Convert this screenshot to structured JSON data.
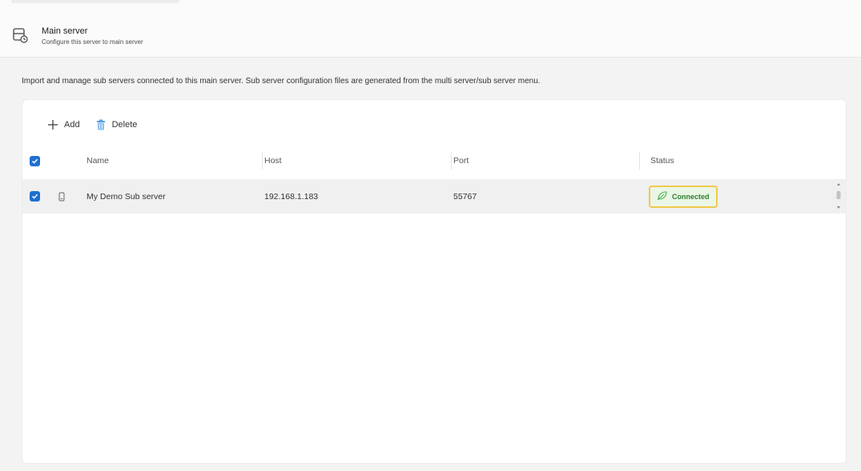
{
  "header": {
    "title": "Main server",
    "subtitle": "Configure this server to main server",
    "icon": "server-icon"
  },
  "description": "Import and manage sub servers connected to this main server. Sub server configuration files are generated from the multi server/sub server menu.",
  "toolbar": {
    "add_label": "Add",
    "delete_label": "Delete"
  },
  "table": {
    "columns": [
      "Name",
      "Host",
      "Port",
      "Status"
    ],
    "rows": [
      {
        "selected": true,
        "name": "My Demo Sub server",
        "host": "192.168.1.183",
        "port": "55767",
        "status": "Connected"
      }
    ]
  },
  "colors": {
    "accent": "#1f6fd1",
    "status_connected_text": "#2f7d32",
    "status_connected_bg": "#eaf6e6",
    "highlight_border": "#f2c94c"
  }
}
